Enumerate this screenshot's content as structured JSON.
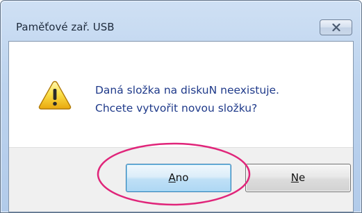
{
  "window": {
    "title": "Paměťové zař. USB"
  },
  "dialog": {
    "message_line1": "Daná složka na diskuN neexistuje.",
    "message_line2": "Chcete vytvořit novou složku?",
    "icon": "warning-icon"
  },
  "buttons": {
    "yes_accel": "A",
    "yes_rest": "no",
    "no_accel": "N",
    "no_rest": "e"
  },
  "colors": {
    "message_text": "#1f3a8a",
    "highlight_ellipse": "#e0257a",
    "default_button_border": "#3c7fb1"
  }
}
